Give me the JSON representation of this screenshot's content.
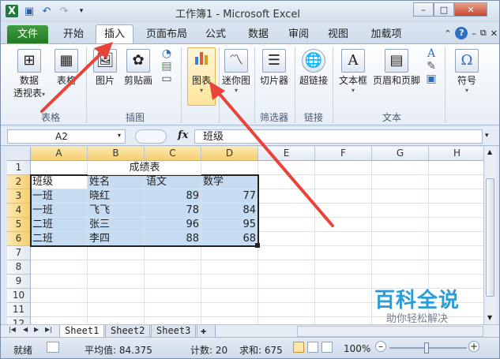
{
  "window": {
    "title": "工作簿1 - Microsoft Excel",
    "minimize": "–",
    "restore": "□",
    "close": "✕"
  },
  "ribbon_tabs": {
    "file": "文件",
    "items": [
      "开始",
      "插入",
      "页面布局",
      "公式",
      "数据",
      "审阅",
      "视图",
      "加载项"
    ],
    "active": "插入"
  },
  "ribbon": {
    "buttons": {
      "pivot": "数据\n透视表",
      "pivot_line1": "数据",
      "pivot_line2": "透视表",
      "table": "表格",
      "picture": "图片",
      "clipart": "剪贴画",
      "chart": "图表",
      "sparkline": "迷你图",
      "slicer": "切片器",
      "hyperlink": "超链接",
      "textbox": "文本框",
      "headerfooter": "页眉和页脚",
      "symbol": "符号"
    },
    "groups": {
      "tables": "表格",
      "illustrations": "插图",
      "filter": "筛选器",
      "links": "链接",
      "text": "文本"
    }
  },
  "formula_bar": {
    "name_box": "A2",
    "fx": "fx",
    "formula": "班级"
  },
  "sheet": {
    "columns": [
      "A",
      "B",
      "C",
      "D",
      "E",
      "F",
      "G",
      "H"
    ],
    "rows": [
      "1",
      "2",
      "3",
      "4",
      "5",
      "6",
      "7",
      "8",
      "9",
      "10",
      "11",
      "12"
    ],
    "title_cell": "成绩表",
    "header": [
      "班级",
      "姓名",
      "语文",
      "数学"
    ],
    "data": [
      [
        "一班",
        "晓红",
        "89",
        "77"
      ],
      [
        "一班",
        "飞飞",
        "78",
        "84"
      ],
      [
        "二班",
        "张三",
        "96",
        "95"
      ],
      [
        "二班",
        "李四",
        "88",
        "68"
      ]
    ]
  },
  "sheet_tabs": [
    "Sheet1",
    "Sheet2",
    "Sheet3"
  ],
  "status_bar": {
    "mode": "就绪",
    "average": "平均值: 84.375",
    "count": "计数: 20",
    "sum": "求和: 675",
    "zoom": "100%",
    "zoom_minus": "–",
    "zoom_plus": "+"
  },
  "watermark": {
    "title": "百科全说",
    "subtitle": "助你轻松解决"
  },
  "colors": {
    "file_tab": "#227a22",
    "selection_fill": "#c6dcf2",
    "header_selected": "#f6cf6e",
    "arrow": "#e8443a",
    "watermark": "#2b9cd6"
  }
}
